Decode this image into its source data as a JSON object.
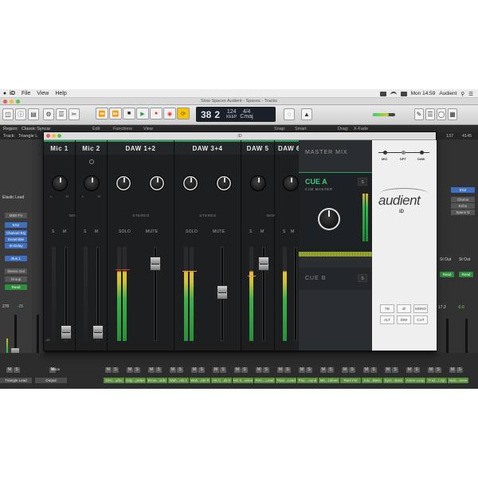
{
  "menubar": {
    "apple": "",
    "items": [
      "iD",
      "File",
      "View",
      "Help"
    ],
    "right": {
      "time": "Mon 14:59",
      "user": "Audient"
    }
  },
  "logic": {
    "window_title": "Slow Spaces Audient - Spaces - Tracks",
    "lcd": {
      "bar": "38",
      "beat": "2",
      "bar_label": "BAR",
      "beat_label": "BEAT",
      "tempo": "124",
      "tempo_label": "KEEP",
      "signature": "4/4",
      "key": "Cmaj"
    },
    "region_label": "Region:",
    "region_value": "Classic Syncar",
    "track_label": "Track:",
    "track_value": "Triangle L",
    "menus": {
      "edit": "Edit",
      "functions": "Functions",
      "view": "View",
      "snap_label": "Snap:",
      "snap_value": "Smart",
      "drag_label": "Drag:",
      "drag_value": "X-Fade"
    },
    "inspector": {
      "instrument": "Elastic Lead",
      "midi_fx": "MIDI FX",
      "input": "ES2",
      "plugins": [
        "Channel EQ",
        "Ensemble",
        "St-Delay"
      ],
      "bus": "Bus 1",
      "output": "Stereo Out",
      "group": "Group",
      "automation": "Read",
      "vol1": "270",
      "vol2": "-26",
      "strip1_name": "Triangle Lead",
      "strip2_name": "Output",
      "strip_extra": "Bnce"
    },
    "right": {
      "counter": "137",
      "counter2": "4145",
      "pad": "Chorus",
      "pad2": "Echo",
      "pad3": "Space D",
      "es2": "ES2",
      "out": "St Out",
      "read": "Read",
      "vol": "17.2",
      "vol2": "-0.0"
    },
    "tracks": [
      "Drm...urbo",
      "Drip...prdes",
      "Brow...ords",
      "Wah...rds L",
      "Wah...rds R",
      "HS C...ds II",
      "HS S...arine",
      "Perc...Lead",
      "Trian...Lead",
      "Pluc...ound",
      "MK...rdines",
      "Reel Fet",
      "Juic...Bass",
      "Synt...Bass",
      "Amen Loop",
      "Fruit...t.zip",
      "Nois...eese"
    ]
  },
  "plugin": {
    "title": "iD",
    "channels": [
      {
        "name": "Mic 1",
        "mode": "MONO",
        "solo": "S",
        "mute": "M"
      },
      {
        "name": "Mic 2",
        "mode": "",
        "solo": "S",
        "mute": "M"
      },
      {
        "name": "DAW 1+2",
        "mode": "STEREO",
        "solo": "SOLO",
        "mute": "MUTE"
      },
      {
        "name": "DAW 3+4",
        "mode": "STEREO",
        "solo": "SOLO",
        "mute": "MUTE"
      },
      {
        "name": "DAW 5",
        "mode": "MONO",
        "solo": "S",
        "mute": "M"
      },
      {
        "name": "DAW 6",
        "mode": "",
        "solo": "S",
        "mute": "M"
      }
    ],
    "master": {
      "title": "MASTER MIX",
      "cue_a": "CUE A",
      "cue_a_sub": "CUE MASTER",
      "cue_b": "CUE B",
      "s_label": "S"
    },
    "brand": {
      "name": "audient",
      "model": "iD"
    },
    "source": {
      "labels": [
        "MIC",
        "DPT",
        "DAW"
      ]
    },
    "functions": [
      "TB",
      "Ø",
      "MONO",
      "ALT",
      "DIM",
      "CUT"
    ],
    "lr": {
      "l": "L",
      "r": "R"
    },
    "scale_low": "-40"
  }
}
